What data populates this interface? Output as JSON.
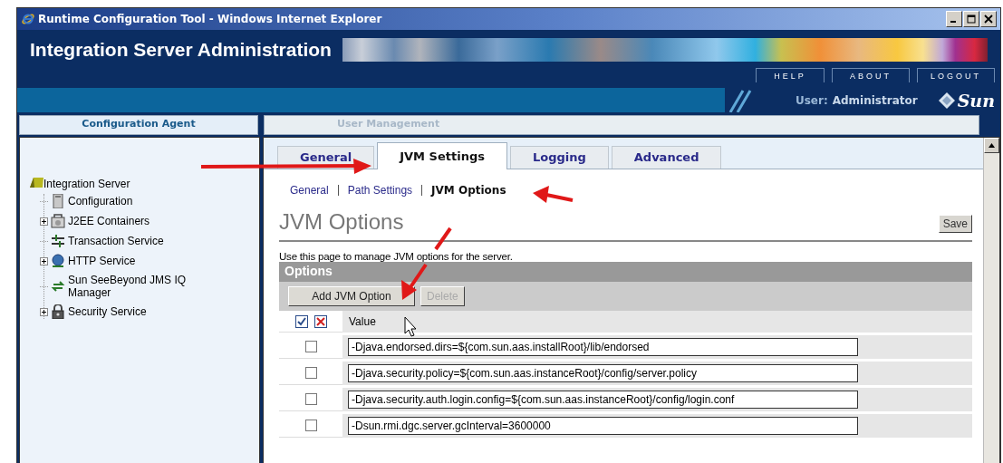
{
  "window": {
    "title": "Runtime Configuration Tool - Windows Internet Explorer"
  },
  "header": {
    "title": "Integration Server Administration",
    "links": [
      {
        "label": "HELP"
      },
      {
        "label": "ABOUT"
      },
      {
        "label": "LOGOUT"
      }
    ],
    "user_label": "User:",
    "user_name": "Administrator",
    "logo_text": "Sun"
  },
  "top_tabs": [
    {
      "label": "Configuration Agent",
      "selected": true
    },
    {
      "label": "User Management",
      "selected": false
    }
  ],
  "tree": {
    "label": "Integration Server",
    "children": [
      {
        "label": "Configuration",
        "kind": "config",
        "expandable": false
      },
      {
        "label": "J2EE Containers",
        "kind": "containers",
        "expandable": true
      },
      {
        "label": "Transaction Service",
        "kind": "transaction",
        "expandable": false
      },
      {
        "label": "HTTP Service",
        "kind": "http",
        "expandable": true
      },
      {
        "label": "Sun SeeBeyond JMS IQ Manager",
        "kind": "jms",
        "expandable": false
      },
      {
        "label": "Security Service",
        "kind": "security",
        "expandable": true
      }
    ]
  },
  "tabs": [
    {
      "label": "General",
      "selected": false
    },
    {
      "label": "JVM Settings",
      "selected": true
    },
    {
      "label": "Logging",
      "selected": false
    },
    {
      "label": "Advanced",
      "selected": false
    }
  ],
  "subnav": [
    {
      "label": "General",
      "selected": false
    },
    {
      "label": "Path Settings",
      "selected": false
    },
    {
      "label": "JVM Options",
      "selected": true
    }
  ],
  "page": {
    "heading": "JVM Options",
    "save_button": "Save",
    "description": "Use this page to manage JVM options for the server."
  },
  "options": {
    "title": "Options",
    "buttons": [
      {
        "label": "Add JVM Option",
        "disabled": false
      },
      {
        "label": "Delete",
        "disabled": true
      }
    ],
    "value_column": "Value",
    "rows": [
      {
        "checked": false,
        "value": "-Djava.endorsed.dirs=${com.sun.aas.installRoot}/lib/endorsed"
      },
      {
        "checked": false,
        "value": "-Djava.security.policy=${com.sun.aas.instanceRoot}/config/server.policy"
      },
      {
        "checked": false,
        "value": "-Djava.security.auth.login.config=${com.sun.aas.instanceRoot}/config/login.conf"
      },
      {
        "checked": false,
        "value": "-Dsun.rmi.dgc.server.gcInterval=3600000"
      }
    ]
  }
}
